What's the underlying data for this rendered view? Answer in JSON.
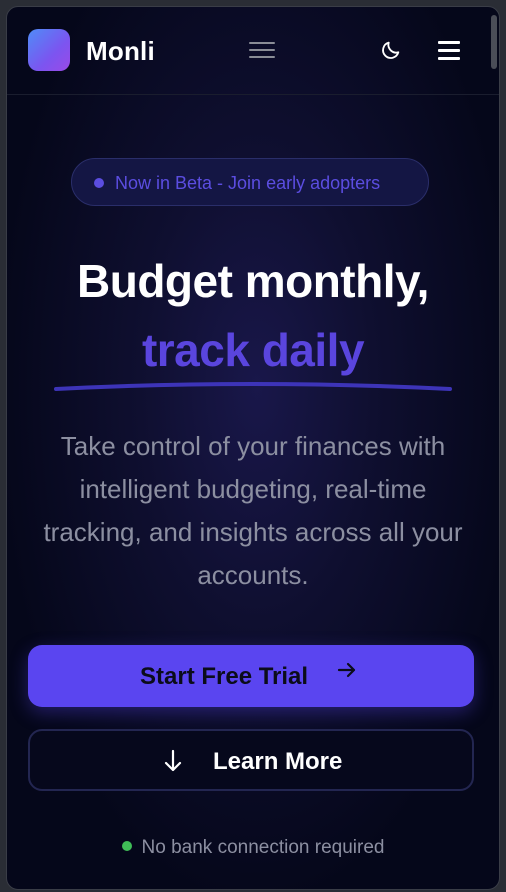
{
  "header": {
    "brand": "Monli",
    "nav_menu_icon": "hamburger-menu-icon",
    "theme_icon": "moon-icon",
    "mobile_menu_icon": "hamburger-menu-icon"
  },
  "hero": {
    "badge_text": "Now in Beta - Join early adopters",
    "title_line1": "Budget monthly,",
    "title_line2": "track daily",
    "description": "Take control of your finances with intelligent budgeting, real-time tracking, and insights across all your accounts."
  },
  "actions": {
    "primary_label": "Start Free Trial",
    "primary_icon": "arrow-right-icon",
    "secondary_label": "Learn More",
    "secondary_icon": "arrow-down-icon"
  },
  "footer_note": "No bank connection required",
  "colors": {
    "accent": "#5a45f0",
    "background": "#05071a",
    "success": "#3fbd57"
  }
}
